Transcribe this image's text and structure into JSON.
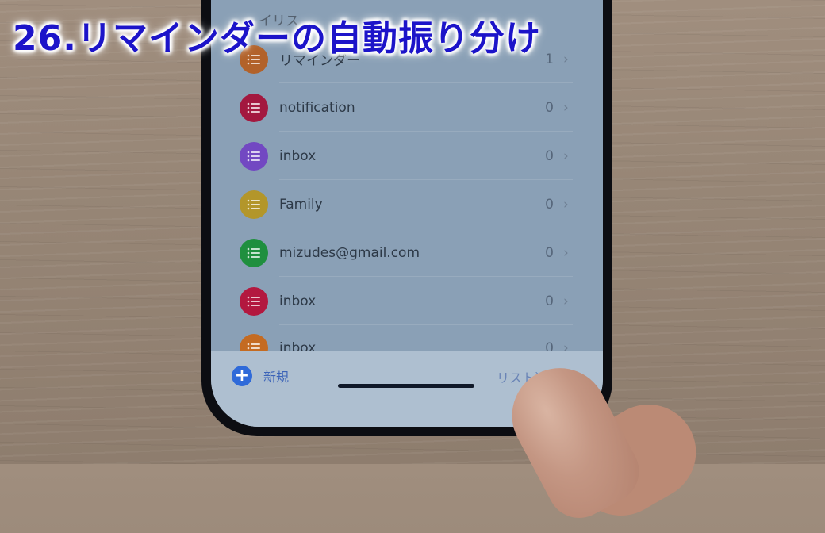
{
  "overlay": {
    "title": "26.リマインダーの自動振り分け"
  },
  "app": {
    "header_partial": "イリス",
    "lists": [
      {
        "name": "リマインダー",
        "count": "1",
        "color": "#b2622a"
      },
      {
        "name": "notification",
        "count": "0",
        "color": "#a3183f"
      },
      {
        "name": "inbox",
        "count": "0",
        "color": "#7248c2"
      },
      {
        "name": "Family",
        "count": "0",
        "color": "#b3962a"
      },
      {
        "name": "mizudes@gmail.com",
        "count": "0",
        "color": "#1f8f3e"
      },
      {
        "name": "inbox",
        "count": "0",
        "color": "#b3183f"
      },
      {
        "name": "inbox",
        "count": "0",
        "color": "#c46b22"
      }
    ],
    "toolbar": {
      "new_label": "新規",
      "add_list_label": "リスト追加"
    }
  },
  "colors": {
    "accent": "#2f6ad9",
    "title_overlay": "#1c14c9"
  }
}
